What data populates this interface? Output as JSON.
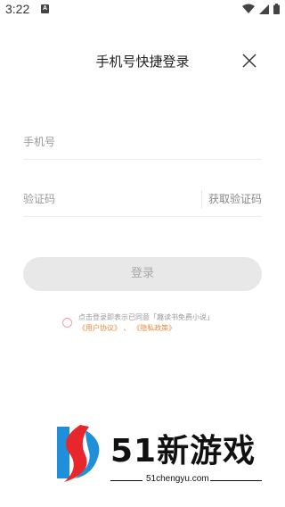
{
  "status_bar": {
    "time": "3:22",
    "notification_icon": "a-icon",
    "icons": [
      "wifi-icon",
      "signal-icon",
      "battery-icon"
    ]
  },
  "header": {
    "title": "手机号快捷登录",
    "close_icon": "close-icon"
  },
  "form": {
    "phone_placeholder": "手机号",
    "code_placeholder": "验证码",
    "get_code_label": "获取验证码",
    "login_label": "登录"
  },
  "agreement": {
    "text": "点击登录即表示已同意「趣读书免费小说」",
    "user_agreement": "《用户协议》",
    "separator": "、",
    "privacy_policy": "《隐私政策》"
  },
  "watermark": {
    "name": "51新游戏",
    "url": "51chengyu.com",
    "colors": {
      "red": "#e8272d",
      "blue": "#1e8fd8",
      "text": "#111111"
    }
  }
}
